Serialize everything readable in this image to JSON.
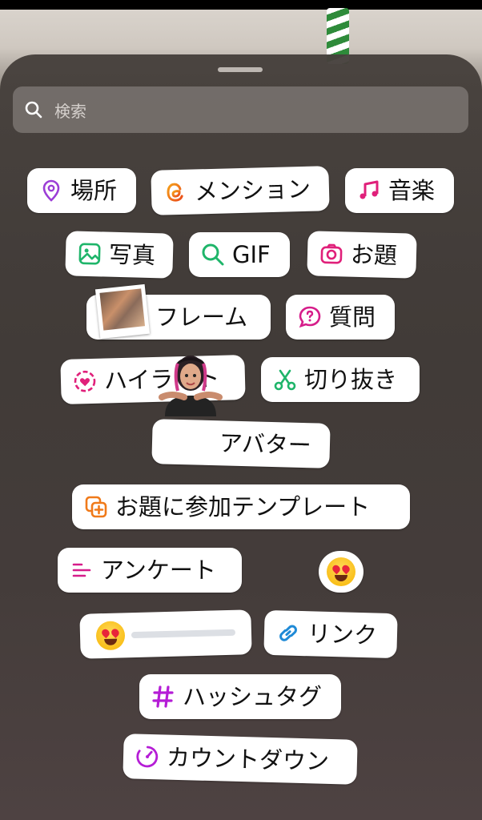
{
  "search": {
    "placeholder": "検索"
  },
  "stickers": [
    {
      "label": "場所",
      "icon": "location-pin-icon",
      "color": "#9b3dd6"
    },
    {
      "label": "メンション",
      "icon": "threads-at-icon",
      "color": "#f07a1a"
    },
    {
      "label": "音楽",
      "icon": "music-note-icon",
      "color": "#e0207a"
    },
    {
      "label": "写真",
      "icon": "photo-icon",
      "color": "#1fb56a"
    },
    {
      "label": "GIF",
      "icon": "search-icon",
      "color": "#1fb56a"
    },
    {
      "label": "お題",
      "icon": "camera-icon",
      "color": "#e0207a"
    },
    {
      "label": "フレーム",
      "icon": "frame-photo-icon",
      "color": "#333333"
    },
    {
      "label": "質問",
      "icon": "question-icon",
      "color": "#d61d8a"
    },
    {
      "label": "ハイライト",
      "icon": "highlight-heart-icon",
      "color": "#e0207a"
    },
    {
      "label": "切り抜き",
      "icon": "scissors-icon",
      "color": "#1fb56a"
    },
    {
      "label": "アバター",
      "icon": "avatar-icon",
      "color": "#333333"
    },
    {
      "label": "お題に参加テンプレート",
      "icon": "add-template-icon",
      "color": "#f07a1a"
    },
    {
      "label": "アンケート",
      "icon": "poll-icon",
      "color": "#d61d8a"
    },
    {
      "label": "リンク",
      "icon": "link-icon",
      "color": "#1f8ad6"
    },
    {
      "label": "ハッシュタグ",
      "icon": "hashtag-icon",
      "color": "#b51dd6"
    },
    {
      "label": "カウントダウン",
      "icon": "countdown-icon",
      "color": "#b51dd6"
    }
  ],
  "emoji_stickers": {
    "reaction": "heart-eyes-emoji-icon",
    "slider": "emoji-slider-icon"
  }
}
